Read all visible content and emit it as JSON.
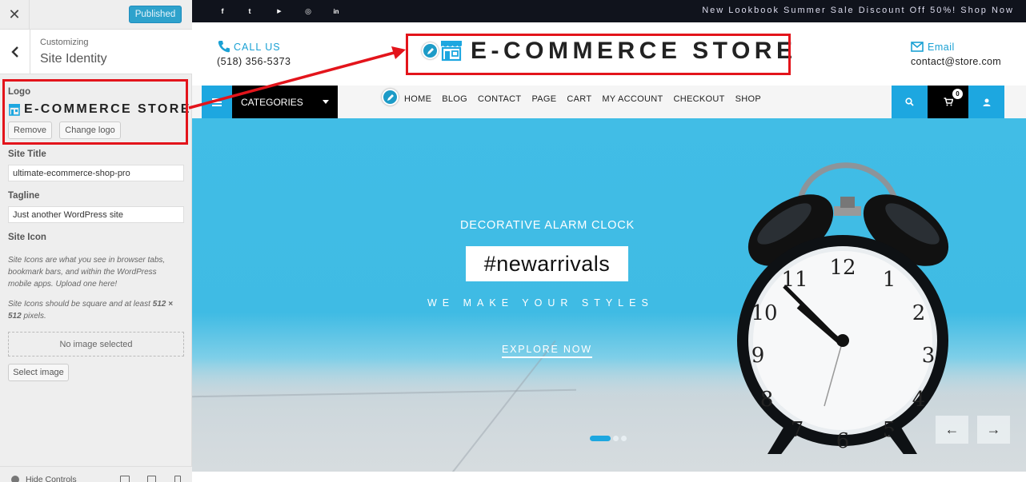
{
  "customizer": {
    "close_label": "✕",
    "publish_label": "Published",
    "breadcrumb_label": "Customizing",
    "section_title": "Site Identity",
    "logo": {
      "label": "Logo",
      "logo_text": "E-COMMERCE STORE",
      "remove_label": "Remove",
      "change_label": "Change logo"
    },
    "site_title": {
      "label": "Site Title",
      "value": "ultimate-ecommerce-shop-pro"
    },
    "tagline": {
      "label": "Tagline",
      "value": "Just another WordPress site"
    },
    "site_icon": {
      "label": "Site Icon",
      "description_1": "Site Icons are what you see in browser tabs, bookmark bars, and within the WordPress mobile apps. Upload one here!",
      "description_2_pre": "Site Icons should be square and at least ",
      "description_2_bold": "512 × 512",
      "description_2_post": " pixels.",
      "no_image": "No image selected",
      "select_label": "Select image"
    },
    "footer": {
      "hide_controls_label": "Hide Controls"
    }
  },
  "site": {
    "social_icons": [
      "facebook-icon",
      "twitter-icon",
      "youtube-icon",
      "instagram-icon",
      "linkedin-icon"
    ],
    "social_glyphs": [
      "f",
      "t",
      "▶",
      "◎",
      "in"
    ],
    "promo": "New Lookbook Summer Sale Discount Off 50%! Shop Now",
    "call_label": "CALL US",
    "phone": "(518) 356-5373",
    "logo_text": "E-COMMERCE STORE",
    "email_label": "Email",
    "email": "contact@store.com",
    "categories_label": "CATEGORIES",
    "nav": [
      "HOME",
      "BLOG",
      "CONTACT",
      "PAGE",
      "CART",
      "MY ACCOUNT",
      "CHECKOUT",
      "SHOP"
    ],
    "cart_count": "0",
    "hero": {
      "subtitle": "DECORATIVE ALARM CLOCK",
      "tag": "#newarrivals",
      "slogan": "WE MAKE YOUR STYLES",
      "cta": "EXPLORE NOW",
      "prev": "←",
      "next": "→"
    }
  },
  "colors": {
    "accent": "#1da7e0",
    "highlight": "#e3141b",
    "topbar": "#10131c",
    "publish": "#2ea2cc"
  }
}
